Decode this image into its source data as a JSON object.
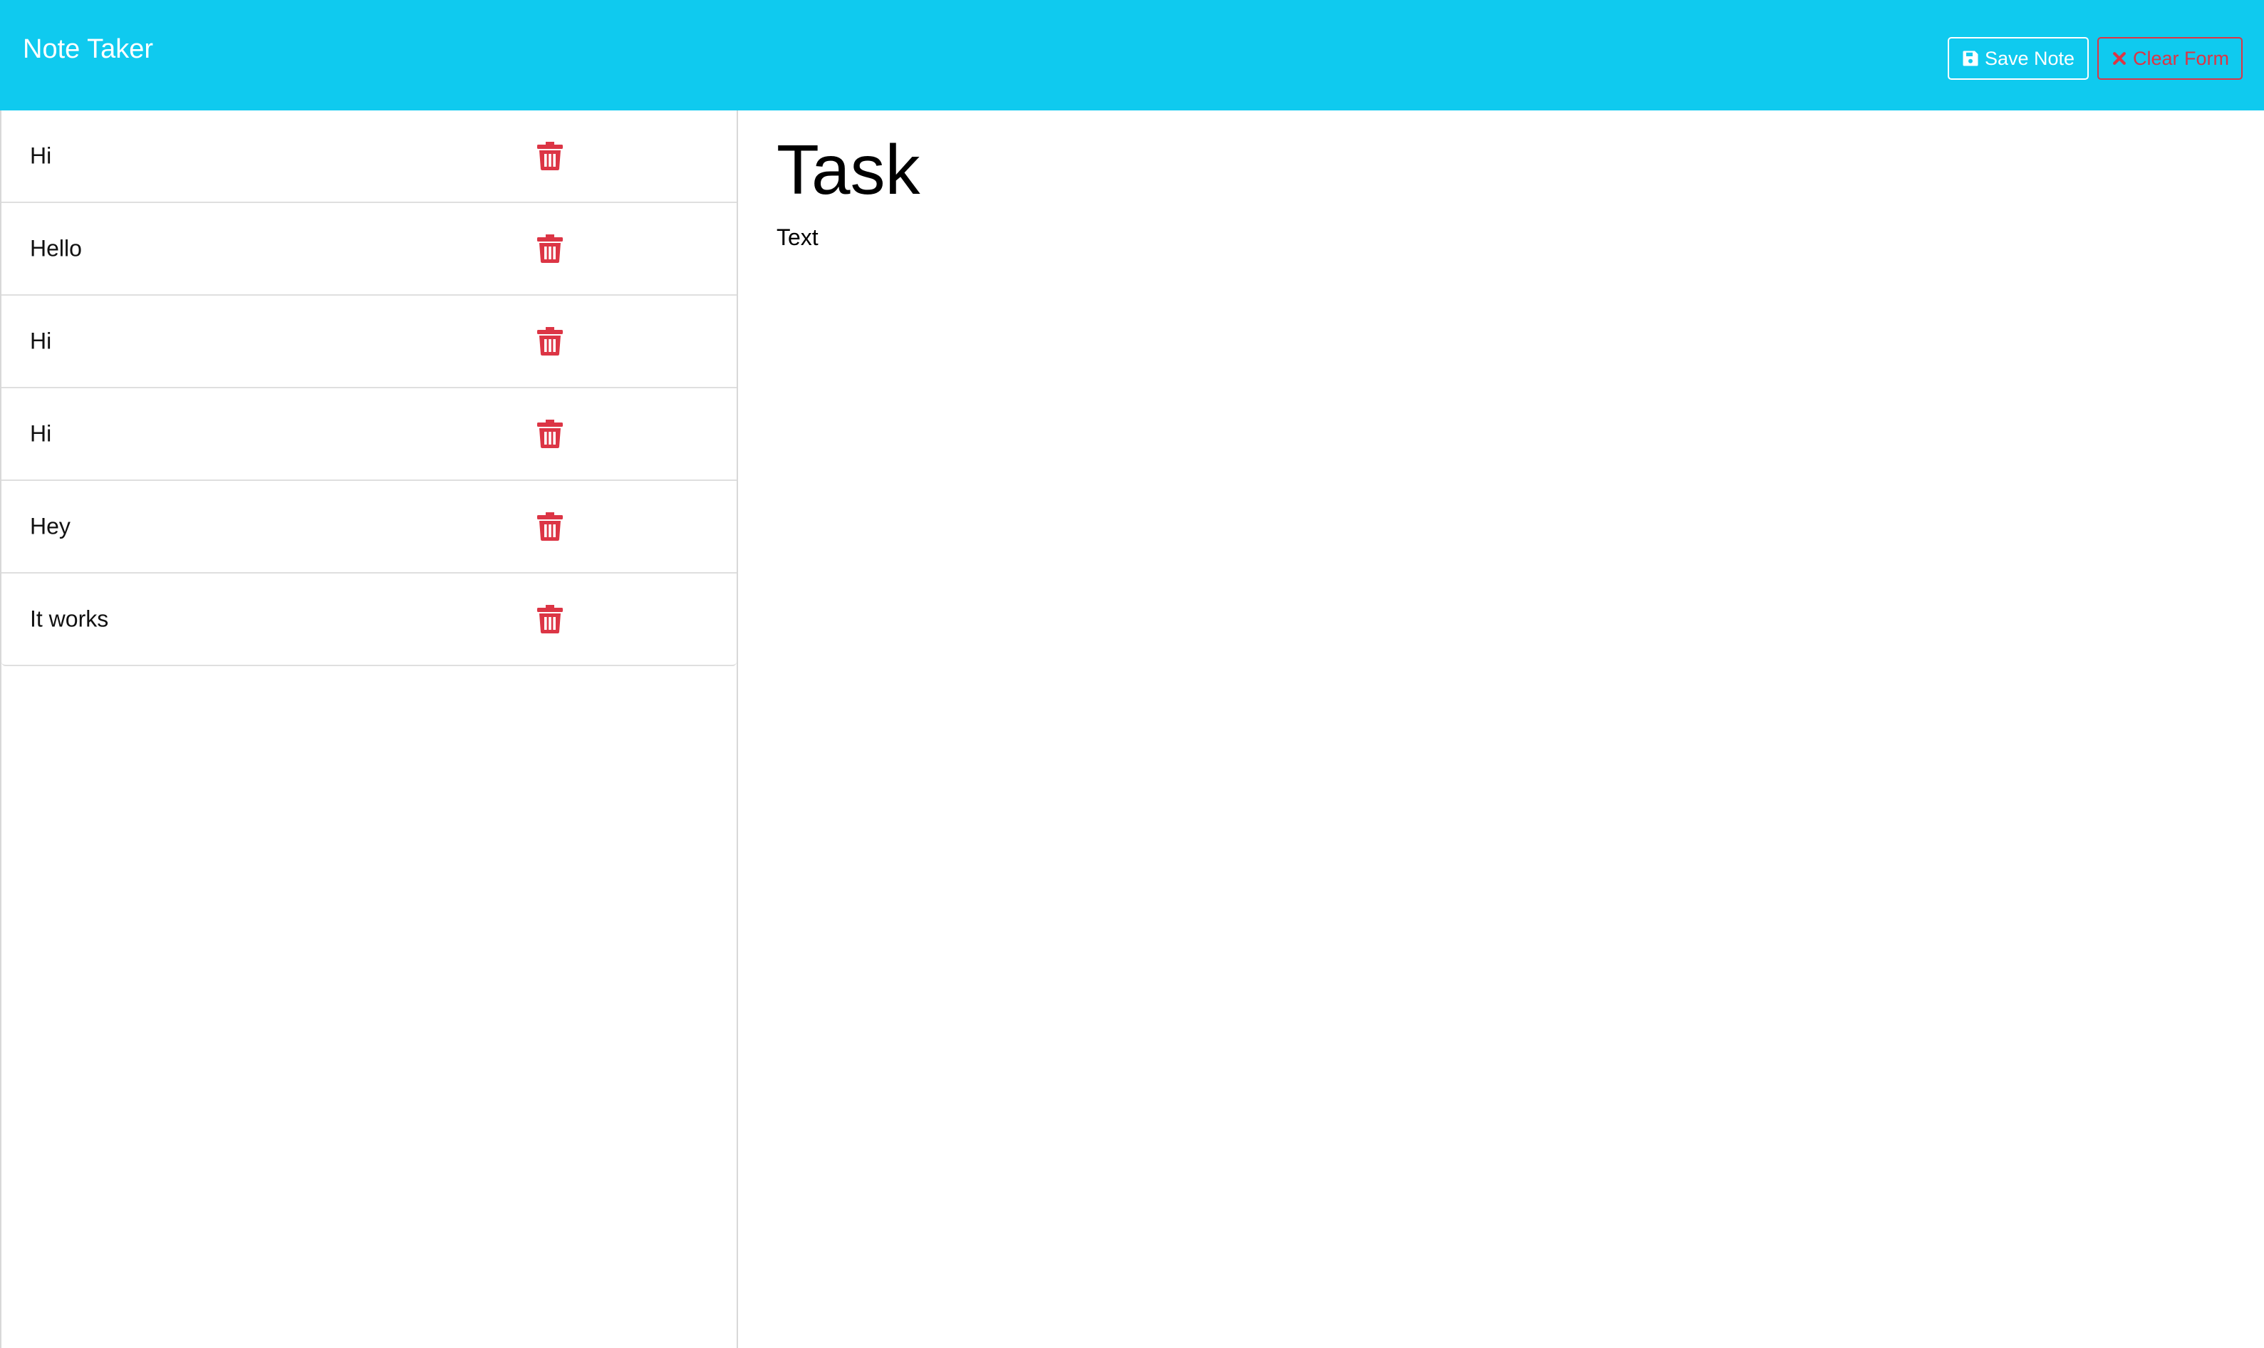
{
  "navbar": {
    "brand": "Note Taker",
    "background_color": "#0fcaef",
    "save_button": {
      "label": "Save Note",
      "icon": "save-icon"
    },
    "clear_button": {
      "label": "Clear Form",
      "icon": "close-icon",
      "color": "#dc3545"
    }
  },
  "sidebar": {
    "notes": [
      {
        "title": "Hi",
        "delete_icon": "trash-icon"
      },
      {
        "title": "Hello",
        "delete_icon": "trash-icon"
      },
      {
        "title": "Hi",
        "delete_icon": "trash-icon"
      },
      {
        "title": "Hi",
        "delete_icon": "trash-icon"
      },
      {
        "title": "Hey",
        "delete_icon": "trash-icon"
      },
      {
        "title": "It works",
        "delete_icon": "trash-icon"
      }
    ],
    "delete_icon_color": "#dc3545"
  },
  "editor": {
    "title": "Task",
    "text": "Text"
  }
}
